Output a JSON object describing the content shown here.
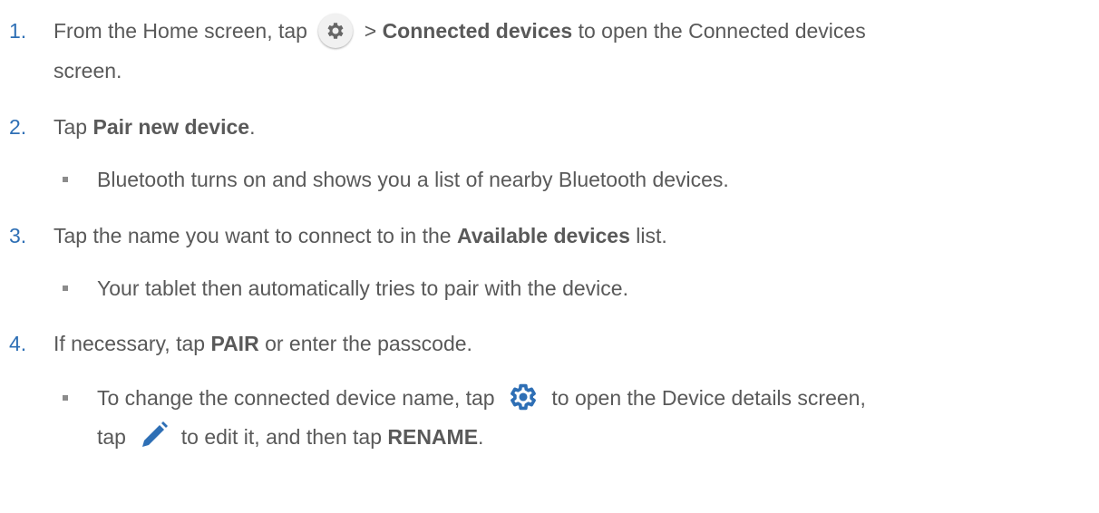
{
  "steps": [
    {
      "number": "1.",
      "prefix": "From the Home screen, tap",
      "icon": "gear-icon",
      "mid": " > ",
      "bold": "Connected devices",
      "suffix": " to open the Connected devices",
      "line2": "screen."
    },
    {
      "number": "2.",
      "prefix": "Tap ",
      "bold": "Pair new device",
      "suffix": ".",
      "bullet": "Bluetooth turns on and shows you a list of nearby Bluetooth devices."
    },
    {
      "number": "3.",
      "prefix": "Tap the name you want to connect to in the ",
      "bold": "Available devices",
      "suffix": " list.",
      "bullet": "Your tablet then automatically tries to pair with the device."
    },
    {
      "number": "4.",
      "prefix": "If necessary, tap ",
      "bold": "PAIR",
      "suffix": " or enter the passcode.",
      "bullet": {
        "a": "To change the connected device name, tap ",
        "icon1": "settings-gear-icon",
        "b": " to open the Device details screen,",
        "c": "tap ",
        "icon2": "pencil-icon",
        "d": " to edit it, and then tap ",
        "bold": "RENAME",
        "e": "."
      }
    }
  ],
  "colors": {
    "text": "#595959",
    "number": "#2e6fb5",
    "icon_blue": "#2e6fb5"
  }
}
